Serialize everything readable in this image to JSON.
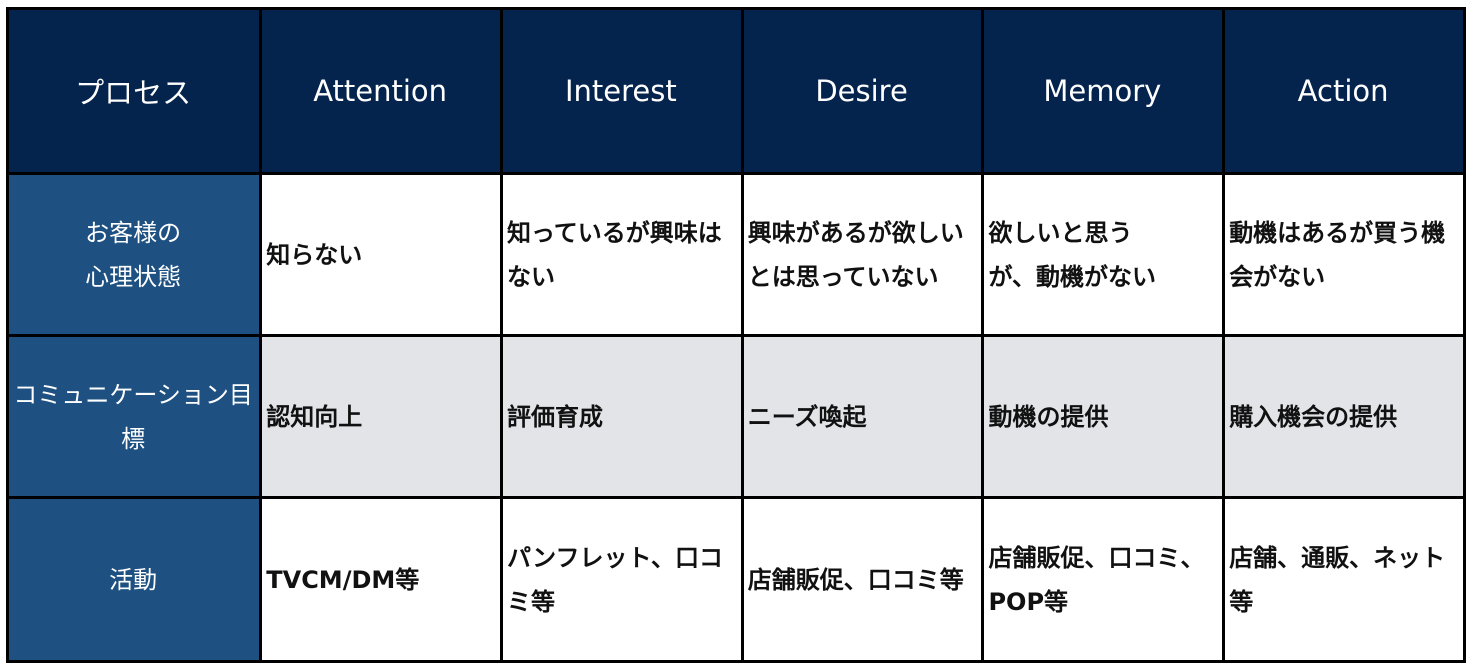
{
  "table": {
    "corner_label": "プロセス",
    "columns": [
      "Attention",
      "Interest",
      "Desire",
      "Memory",
      "Action"
    ],
    "rows": [
      {
        "label": "お客様の\n心理状態",
        "cells": [
          "知らない",
          "知っているが興味はない",
          "興味があるが欲しいとは思っていない",
          "欲しいと思う\nが、動機がない",
          "動機はあるが買う機会がない"
        ]
      },
      {
        "label": "コミュニケーション目標",
        "cells": [
          "認知向上",
          "評価育成",
          "ニーズ喚起",
          "動機の提供",
          "購入機会の提供"
        ]
      },
      {
        "label": "活動",
        "cells": [
          "TVCM/DM等",
          "パンフレット、口コミ等",
          "店舗販促、口コミ等",
          "店舗販促、口コミ、POP等",
          "店舗、通販、ネット等"
        ]
      }
    ]
  },
  "colors": {
    "header_bg": "#04234d",
    "row_header_bg": "#1e5082",
    "highlight_row_bg": "#e2e4e8",
    "border": "#000000"
  }
}
